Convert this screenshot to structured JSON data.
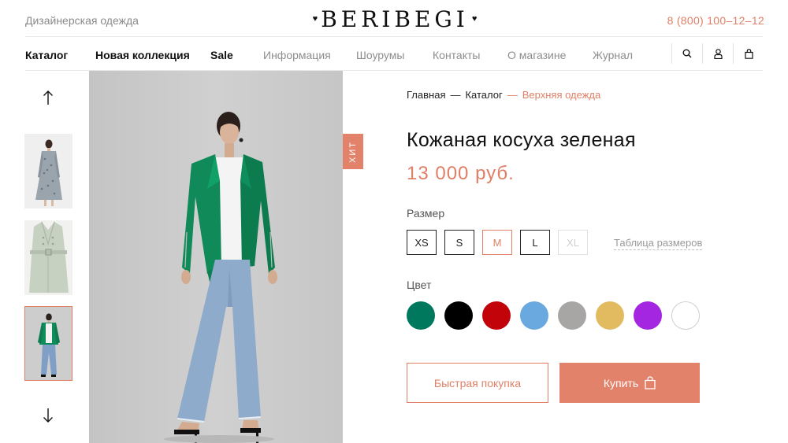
{
  "header": {
    "tagline": "Дизайнерская одежда",
    "logo": "BERIBEGI",
    "phone": "8 (800) 100–12–12"
  },
  "nav": {
    "items": [
      {
        "label": "Каталог"
      },
      {
        "label": "Новая коллекция"
      },
      {
        "label": "Sale"
      },
      {
        "label": "Информация"
      },
      {
        "label": "Шоурумы"
      },
      {
        "label": "Контакты"
      },
      {
        "label": "О магазине"
      },
      {
        "label": "Журнал"
      }
    ],
    "icons": [
      "search-icon",
      "user-icon",
      "cart-icon"
    ]
  },
  "gallery": {
    "thumbnails": [
      "floral-dress",
      "trench-coat",
      "green-leather-jacket"
    ],
    "active_index": 2,
    "badge": "ХИТ"
  },
  "product": {
    "breadcrumb": [
      "Главная",
      "Каталог",
      "Верхняя одежда"
    ],
    "breadcrumb_sep": "—",
    "title": "Кожаная косуха зеленая",
    "price": "13 000 руб.",
    "size_label": "Размер",
    "sizes": [
      "XS",
      "S",
      "M",
      "L",
      "XL"
    ],
    "selected_size": "M",
    "disabled_size": "XL",
    "size_table_link": "Таблица размеров",
    "color_label": "Цвет",
    "colors": [
      "#00785e",
      "#000000",
      "#c20309",
      "#6aa9e0",
      "#a8a5a5",
      "#e2bb60",
      "#a526e0",
      "#ffffff"
    ],
    "quick_buy_label": "Быстрая покупка",
    "buy_label": "Купить"
  },
  "theme": {
    "accent": "#e07f66"
  }
}
